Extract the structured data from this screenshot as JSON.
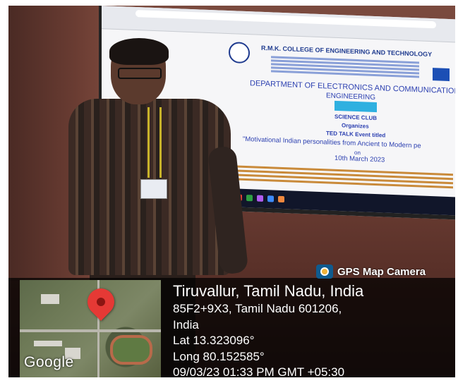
{
  "gps_label": "GPS Map Camera",
  "location": {
    "city": "Tiruvallur, Tamil Nadu, India",
    "address_line1": "85F2+9X3, Tamil Nadu 601206,",
    "address_line2": "India",
    "latitude": "Lat 13.323096°",
    "longitude": "Long 80.152585°",
    "datetime": "09/03/23 01:33 PM GMT +05:30"
  },
  "map_brand": "Google",
  "projected_slide": {
    "college": "R.M.K. COLLEGE OF ENGINEERING AND TECHNOLOGY",
    "department": "DEPARTMENT OF  ELECTRONICS AND COMMUNICATION",
    "department_2": "ENGINEERING",
    "club": "SCIENCE CLUB",
    "organizes": "Organizes",
    "event_type": "TED TALK  Event titled",
    "event_title": "\"Motivational Indian personalities from Ancient to Modern pe",
    "on": "on",
    "date": "10th March 2023"
  },
  "colors": {
    "overlay": "#000000",
    "pin": "#e53935",
    "slide_text": "#2b3fb0"
  },
  "icons": [
    "gps-camera-icon",
    "map-pin-icon"
  ]
}
